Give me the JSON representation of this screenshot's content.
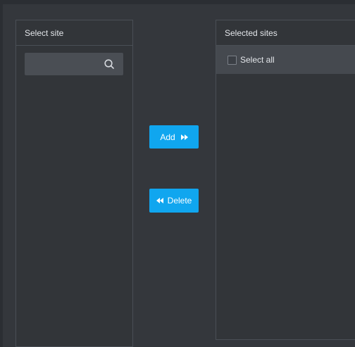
{
  "left_panel": {
    "title": "Select site",
    "search": {
      "value": "",
      "placeholder": "",
      "icon": "search-icon"
    }
  },
  "right_panel": {
    "title": "Selected sites",
    "select_all_label": "Select all",
    "select_all_checked": false
  },
  "actions": {
    "add_label": "Add",
    "add_icon": "double-arrow-right-icon",
    "delete_label": "Delete",
    "delete_icon": "double-arrow-left-icon"
  },
  "colors": {
    "accent": "#10a6ef",
    "panel_bg": "#323539",
    "border": "#4a4f56"
  }
}
